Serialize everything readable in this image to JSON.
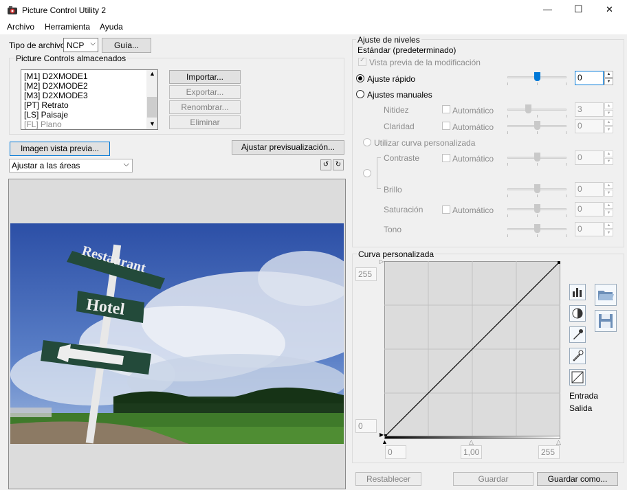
{
  "window": {
    "title": "Picture Control Utility 2",
    "minimize": "—",
    "maximize": "☐",
    "close": "✕"
  },
  "menu": [
    "Archivo",
    "Herramienta",
    "Ayuda"
  ],
  "left": {
    "file_type_label": "Tipo de archivo",
    "file_type_value": "NCP",
    "guide_button": "Guía...",
    "stored_group_label": "Picture Controls almacenados",
    "stored_list": [
      "[M1] D2XMODE1",
      "[M2] D2XMODE2",
      "[M3] D2XMODE3",
      "[PT] Retrato",
      "[LS] Paisaje",
      "[FL] Plano"
    ],
    "import_button": "Importar...",
    "export_button": "Exportar...",
    "rename_button": "Renombrar...",
    "delete_button": "Eliminar",
    "preview_image_button": "Imagen vista previa...",
    "adjust_preview_button": "Ajustar previsualización...",
    "fit_select": "Ajustar a las áreas",
    "image_signs": {
      "restaurant": "Restaurant",
      "hotel": "Hotel"
    }
  },
  "right": {
    "levels_group": "Ajuste de niveles",
    "preset_name": "Estándar (predeterminado)",
    "preview_mod_label": "Vista previa de la modificación",
    "quick_adjust_label": "Ajuste rápido",
    "quick_adjust_value": "0",
    "manual_label": "Ajustes manuales",
    "sharpness_label": "Nitidez",
    "sharpness_value": "3",
    "clarity_label": "Claridad",
    "clarity_value": "0",
    "auto_label": "Automático",
    "custom_curve_option": "Utilizar curva personalizada",
    "contrast_label": "Contraste",
    "contrast_value": "0",
    "brightness_label": "Brillo",
    "brightness_value": "0",
    "saturation_label": "Saturación",
    "saturation_value": "0",
    "hue_label": "Tono",
    "hue_value": "0",
    "curve_group": "Curva personalizada",
    "curve_top_value": "255",
    "curve_bottom_value": "0",
    "input_min": "0",
    "input_gamma": "1,00",
    "input_max": "255",
    "entrada_label": "Entrada",
    "salida_label": "Salida",
    "reset_button": "Restablecer",
    "save_button": "Guardar",
    "save_as_button": "Guardar como..."
  },
  "colors": {
    "accent": "#0078d7",
    "disabled_text": "#8c8c8c"
  }
}
